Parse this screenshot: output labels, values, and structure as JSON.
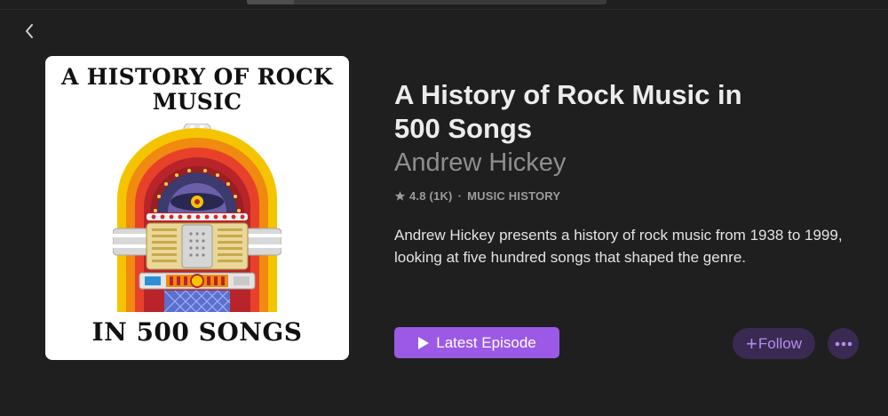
{
  "player": {
    "progress": 0.13
  },
  "navigation": {
    "back_icon": "chevron-left-icon"
  },
  "artwork": {
    "title_line1": "A HISTORY OF ROCK",
    "title_line2": "MUSIC",
    "title_bottom": "IN 500 SONGS"
  },
  "podcast": {
    "title": "A History of Rock Music in 500 Songs",
    "author": "Andrew Hickey",
    "rating_icon": "star-icon",
    "rating": "4.8 (1K)",
    "separator": "·",
    "category": "MUSIC HISTORY",
    "description": "Andrew Hickey presents a history of rock music from 1938 to 1999, looking at five hundred songs that shaped the genre."
  },
  "actions": {
    "latest_episode_label": "Latest Episode",
    "follow_symbol": "+",
    "follow_label": "Follow",
    "more_icon": "ellipsis-icon"
  },
  "colors": {
    "background": "#1f1f1f",
    "accent": "#9b59e6",
    "accent_soft_bg": "#3a2a52",
    "accent_text": "#b58cf0"
  }
}
